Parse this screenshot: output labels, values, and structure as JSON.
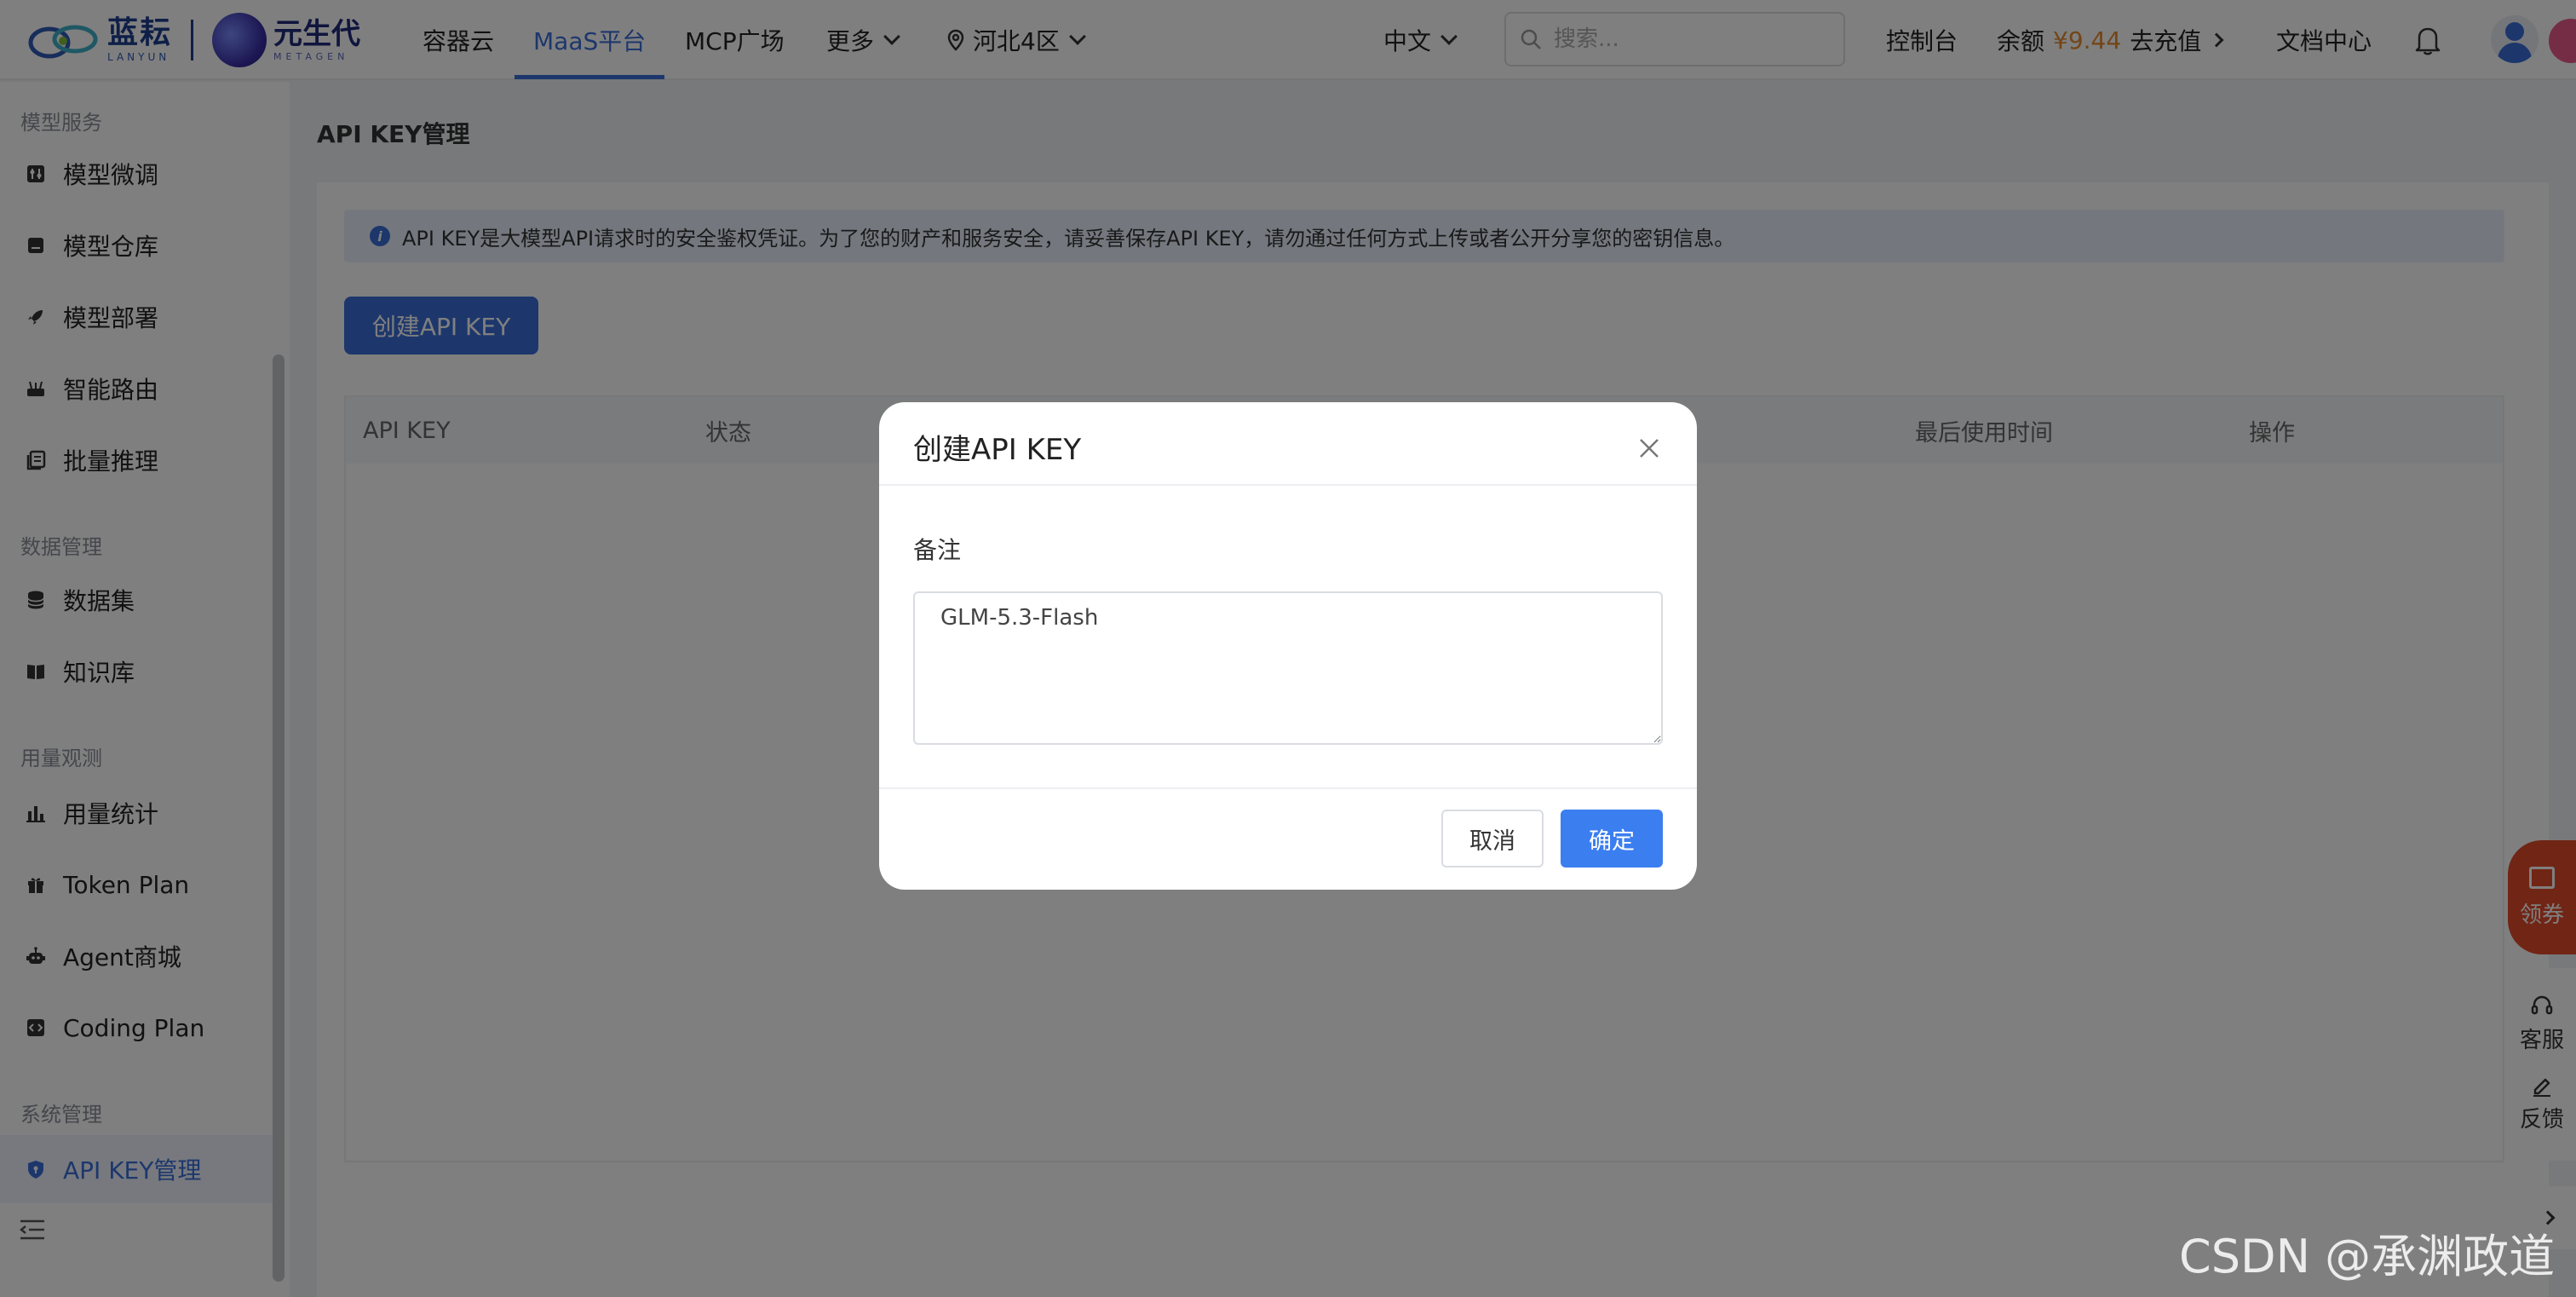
{
  "brand": {
    "logo1_cn": "蓝耘",
    "logo1_en": "LANYUN",
    "logo2_cn": "元生代",
    "logo2_en": "METAGEN"
  },
  "nav": {
    "items": [
      "容器云",
      "MaaS平台",
      "MCP广场",
      "更多"
    ],
    "active": "MaaS平台",
    "region": "河北4区",
    "language": "中文",
    "search_placeholder": "搜索...",
    "console": "控制台",
    "balance_label": "余额",
    "balance_amount": "¥9.44",
    "recharge": "去充值",
    "docs": "文档中心"
  },
  "sidebar": {
    "groups": {
      "model_service": "模型服务",
      "data_mgmt": "数据管理",
      "usage": "用量观测",
      "system": "系统管理"
    },
    "items": [
      {
        "label": "模型微调",
        "icon": "tune-icon"
      },
      {
        "label": "模型仓库",
        "icon": "repository-icon"
      },
      {
        "label": "模型部署",
        "icon": "rocket-icon"
      },
      {
        "label": "智能路由",
        "icon": "router-icon"
      },
      {
        "label": "批量推理",
        "icon": "batch-icon"
      },
      {
        "label": "数据集",
        "icon": "database-icon"
      },
      {
        "label": "知识库",
        "icon": "book-icon"
      },
      {
        "label": "用量统计",
        "icon": "bar-chart-icon"
      },
      {
        "label": "Token Plan",
        "icon": "gift-icon"
      },
      {
        "label": "Agent商城",
        "icon": "robot-icon"
      },
      {
        "label": "Coding Plan",
        "icon": "code-icon"
      },
      {
        "label": "API KEY管理",
        "icon": "shield-icon"
      }
    ],
    "active": "API KEY管理"
  },
  "main": {
    "title": "API KEY管理",
    "alert": "API KEY是大模型API请求时的安全鉴权凭证。为了您的财产和服务安全，请妥善保存API KEY，请勿通过任何方式上传或者公开分享您的密钥信息。",
    "create_button": "创建API KEY",
    "columns": [
      "API KEY",
      "状态",
      "最后使用时间",
      "操作"
    ]
  },
  "modal": {
    "title": "创建API KEY",
    "field_label": "备注",
    "remark_value": "GLM-5.3-Flash",
    "cancel": "取消",
    "confirm": "确定"
  },
  "side_widgets": {
    "coupon": "领券",
    "service": "客服",
    "feedback": "反馈"
  },
  "watermark": "CSDN @承渊政道",
  "colors": {
    "accent": "#3b6fd9",
    "balance": "#e68a2e",
    "coupon": "#e24a2a"
  }
}
